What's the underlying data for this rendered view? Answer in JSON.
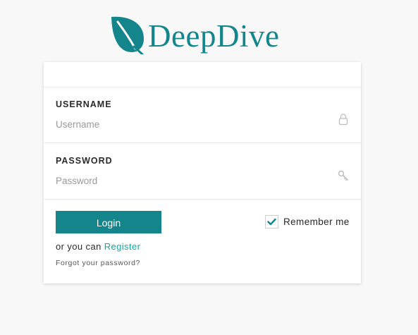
{
  "brand": {
    "name": "DeepDive",
    "logo_icon": "leaf-icon",
    "color": "#14868b"
  },
  "form": {
    "username": {
      "label": "USERNAME",
      "placeholder": "Username",
      "value": "",
      "icon": "lock-icon"
    },
    "password": {
      "label": "PASSWORD",
      "placeholder": "Password",
      "value": "",
      "icon": "key-icon"
    },
    "login_label": "Login",
    "remember_me": {
      "label": "Remember me",
      "checked": true,
      "icon": "checkmark-icon"
    },
    "register_prefix": "or you can",
    "register_link": "Register",
    "forgot_password": "Forgot your password?"
  },
  "colors": {
    "accent": "#14868b",
    "link": "#14a4a0",
    "background": "#f8f8f8"
  }
}
